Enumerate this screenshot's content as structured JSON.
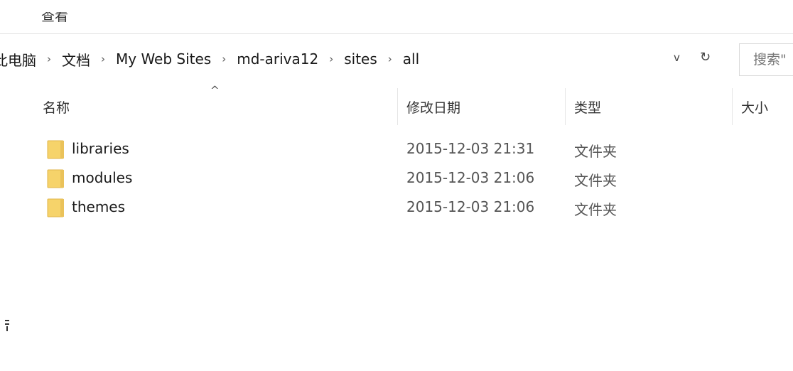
{
  "ribbon": {
    "tab_label": "查看"
  },
  "address": {
    "crumbs": [
      "此电脑",
      "文档",
      "My Web Sites",
      "md-ariva12",
      "sites",
      "all"
    ],
    "separator": "›",
    "dropdown": "v",
    "refresh": "↻"
  },
  "search": {
    "placeholder": "搜索\""
  },
  "columns": {
    "sort_arrow": "^",
    "name": "名称",
    "modified": "修改日期",
    "type": "类型",
    "size": "大小"
  },
  "files": [
    {
      "name": "libraries",
      "modified": "2015-12-03 21:31",
      "type": "文件夹"
    },
    {
      "name": "modules",
      "modified": "2015-12-03 21:06",
      "type": "文件夹"
    },
    {
      "name": "themes",
      "modified": "2015-12-03 21:06",
      "type": "文件夹"
    }
  ],
  "colors": {
    "folder": "#f6d36a",
    "folder_edge": "#e0b64a"
  },
  "icons": {
    "folder": "folder-icon",
    "refresh": "refresh-icon",
    "dropdown": "chevron-down-icon"
  }
}
